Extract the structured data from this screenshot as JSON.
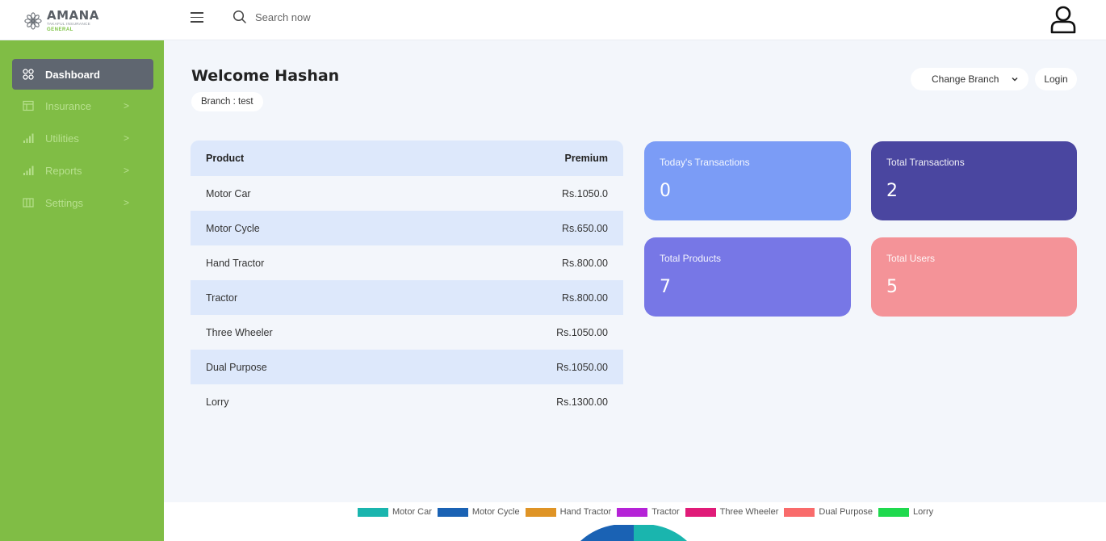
{
  "brand": {
    "name": "AMANA",
    "sub1": "TAKAFUL INSURANCE",
    "sub2": "GENERAL"
  },
  "search": {
    "placeholder": "Search now"
  },
  "sidebar": {
    "items": [
      {
        "label": "Dashboard",
        "icon": "grid-icon",
        "active": true
      },
      {
        "label": "Insurance",
        "icon": "table-icon",
        "chevron": ">"
      },
      {
        "label": "Utilities",
        "icon": "bar-chart-icon",
        "chevron": ">"
      },
      {
        "label": "Reports",
        "icon": "bar-chart-icon",
        "chevron": ">"
      },
      {
        "label": "Settings",
        "icon": "columns-icon",
        "chevron": ">"
      }
    ]
  },
  "welcome": {
    "title": "Welcome Hashan",
    "branch": "Branch : test"
  },
  "controls": {
    "branch_select": "Change Branch",
    "login": "Login"
  },
  "table": {
    "headers": [
      "Product",
      "Premium"
    ],
    "rows": [
      [
        "Motor Car",
        "Rs.1050.0"
      ],
      [
        "Motor Cycle",
        "Rs.650.00"
      ],
      [
        "Hand Tractor",
        "Rs.800.00"
      ],
      [
        "Tractor",
        "Rs.800.00"
      ],
      [
        "Three Wheeler",
        "Rs.1050.00"
      ],
      [
        "Dual Purpose",
        "Rs.1050.00"
      ],
      [
        "Lorry",
        "Rs.1300.00"
      ]
    ]
  },
  "cards": [
    {
      "title": "Today's Transactions",
      "value": "0",
      "color": "#7b9cf6"
    },
    {
      "title": "Total Transactions",
      "value": "2",
      "color": "#4a46a0"
    },
    {
      "title": "Total Products",
      "value": "7",
      "color": "#7777e6"
    },
    {
      "title": "Total Users",
      "value": "5",
      "color": "#f49398"
    }
  ],
  "chart_legend": [
    {
      "label": "Motor Car",
      "color": "#1ab5ae"
    },
    {
      "label": "Motor Cycle",
      "color": "#1a62b4"
    },
    {
      "label": "Hand Tractor",
      "color": "#df9426"
    },
    {
      "label": "Tractor",
      "color": "#b523d7"
    },
    {
      "label": "Three Wheeler",
      "color": "#e01b78"
    },
    {
      "label": "Dual Purpose",
      "color": "#f96b6b"
    },
    {
      "label": "Lorry",
      "color": "#1fd94e"
    }
  ],
  "colors": {
    "sidebar_bg": "#80bd45",
    "sidebar_active": "#5f6670",
    "table_stripe": "#dde8fb"
  }
}
